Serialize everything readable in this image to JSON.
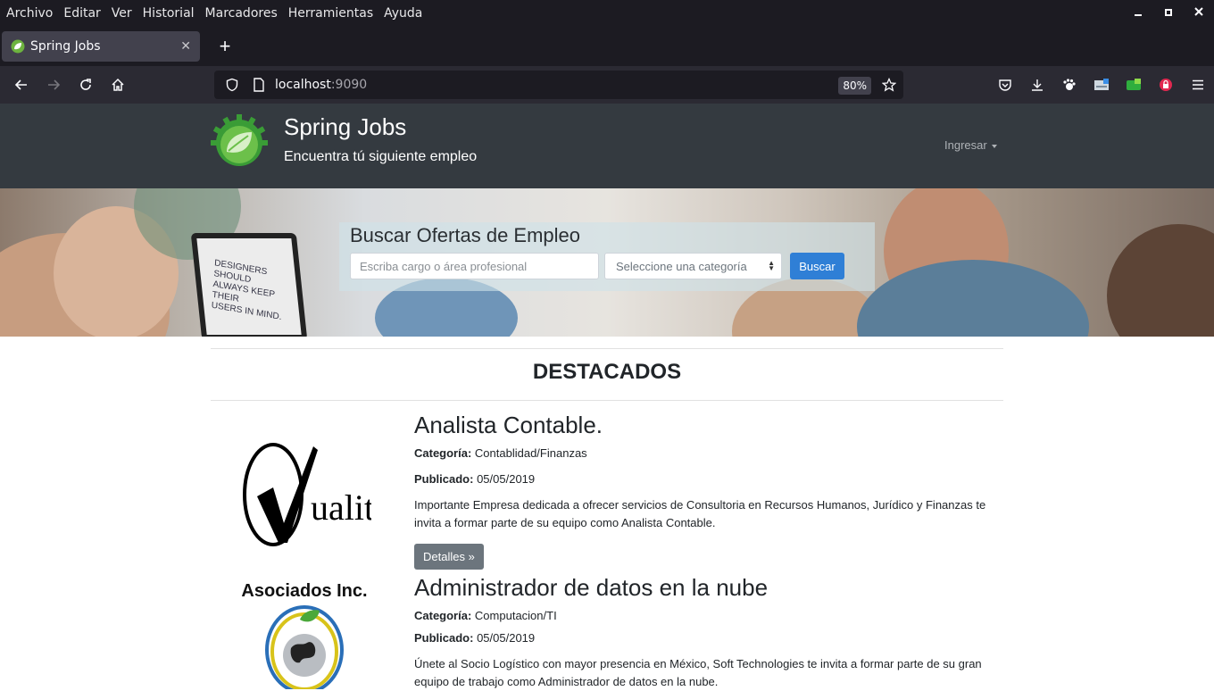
{
  "browser": {
    "menu": [
      "Archivo",
      "Editar",
      "Ver",
      "Historial",
      "Marcadores",
      "Herramientas",
      "Ayuda"
    ],
    "tab_title": "Spring Jobs",
    "url_host": "localhost",
    "url_port": ":9090",
    "zoom": "80%"
  },
  "site": {
    "brand": "Spring Jobs",
    "tagline": "Encuentra tú siguiente empleo",
    "login": "Ingresar"
  },
  "search": {
    "title": "Buscar Ofertas de Empleo",
    "placeholder": "Escriba cargo o área profesional",
    "category_selected": "Seleccione una categoría",
    "button": "Buscar"
  },
  "hero_screen_text": [
    "DESIGNERS SHOULD",
    "ALWAYS KEEP THEIR",
    "USERS IN MIND."
  ],
  "featured_heading": "DESTACADOS",
  "labels": {
    "category": "Categoría:",
    "published": "Publicado:",
    "details": "Detalles »"
  },
  "jobs": [
    {
      "title": "Analista Contable.",
      "category": "Contablidad/Finanzas",
      "published": "05/05/2019",
      "description": "Importante Empresa dedicada a ofrecer servicios de Consultoria en Recursos Humanos, Jurídico y Finanzas te invita a formar parte de su equipo como Analista Contable.",
      "logo_text": "uality"
    },
    {
      "title": "Administrador de datos en la nube",
      "category": "Computacion/TI",
      "published": "05/05/2019",
      "description": "Únete al Socio Logístico con mayor presencia en México, Soft Technologies te invita a formar parte de su gran equipo de trabajo como Administrador de datos en la nube.",
      "logo_text": "Asociados Inc."
    }
  ]
}
